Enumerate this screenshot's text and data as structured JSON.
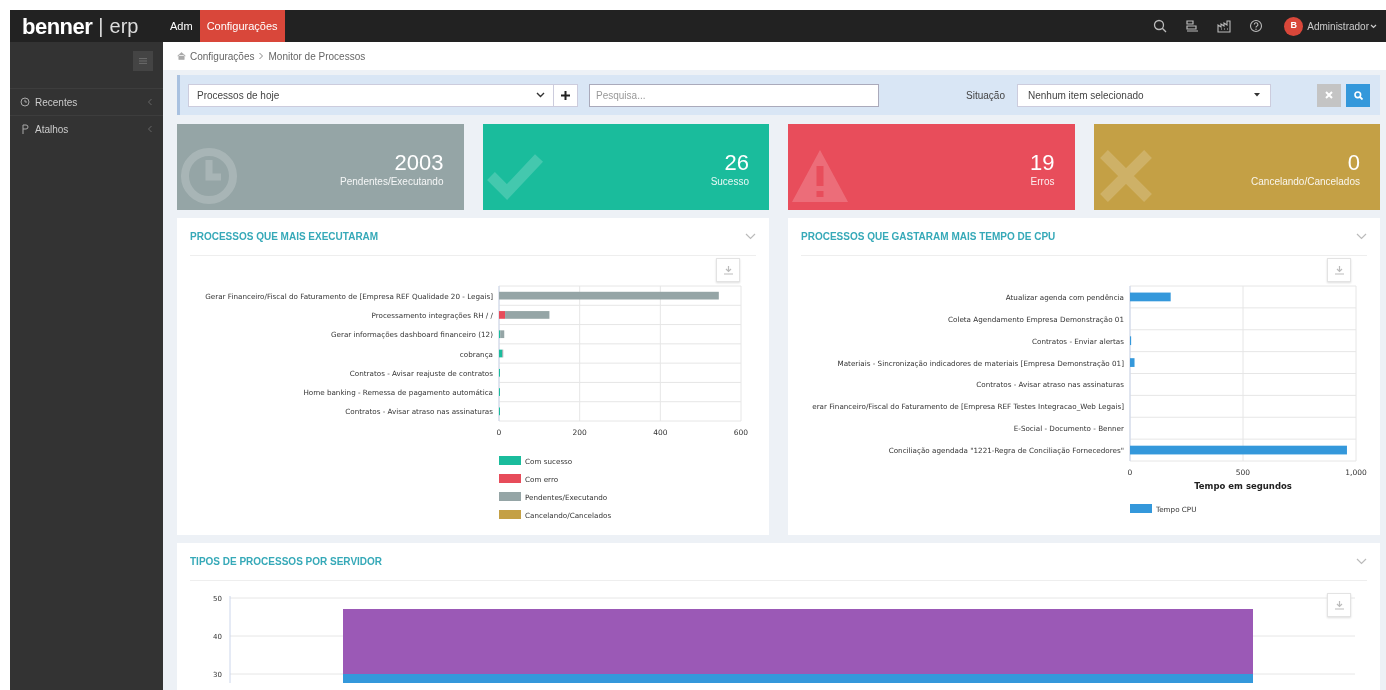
{
  "top_bar": {
    "brand": "benner",
    "separator": "|",
    "product": "erp",
    "tabs": [
      {
        "label": "Adm",
        "selected": false
      },
      {
        "label": "Configurações",
        "selected": true
      }
    ],
    "user": {
      "initial": "B",
      "name": "Administrador"
    }
  },
  "sidebar": {
    "items": [
      {
        "label": "Recentes",
        "kind": "recent"
      },
      {
        "label": "Atalhos",
        "kind": "shortcut"
      }
    ]
  },
  "breadcrumb": [
    "Configurações",
    "Monitor de Processos"
  ],
  "filter_bar": {
    "preset": "Processos de hoje",
    "search_placeholder": "Pesquisa...",
    "status_label": "Situação",
    "status_value": "Nenhum item selecionado"
  },
  "stat_cards": [
    {
      "value": "2003",
      "label": "Pendentes/Executando",
      "kind": "pending"
    },
    {
      "value": "26",
      "label": "Sucesso",
      "kind": "success"
    },
    {
      "value": "19",
      "label": "Erros",
      "kind": "error"
    },
    {
      "value": "0",
      "label": "Cancelando/Cancelados",
      "kind": "cancelled"
    }
  ],
  "panels": [
    {
      "title": "PROCESSOS QUE MAIS EXECUTARAM",
      "chart_data": {
        "type": "bar",
        "orientation": "horizontal",
        "stacked": true,
        "categories": [
          "Gerar Financeiro/Fiscal do Faturamento de [Empresa REF Qualidade 20 - Legais]",
          "Processamento integrações RH / /",
          "Gerar informações dashboard financeiro (12)",
          "cobrança",
          "Contratos - Avisar reajuste de contratos",
          "Home banking - Remessa de pagamento automática",
          "Contratos - Avisar atraso nas assinaturas"
        ],
        "series": [
          {
            "name": "Com sucesso",
            "color": "#1abc9c",
            "values": [
              0,
              0,
              3,
              8,
              1,
              1,
              1
            ]
          },
          {
            "name": "Com erro",
            "color": "#e74c5a",
            "values": [
              0,
              15,
              0,
              0,
              0,
              0,
              0
            ]
          },
          {
            "name": "Pendentes/Executando",
            "color": "#95a5a6",
            "values": [
              545,
              110,
              10,
              2,
              0,
              0,
              0
            ]
          },
          {
            "name": "Cancelando/Cancelados",
            "color": "#c4a045",
            "values": [
              0,
              0,
              0,
              0,
              0,
              0,
              0
            ]
          }
        ],
        "xlim": [
          0,
          600
        ],
        "xticks": [
          0,
          200,
          400,
          600
        ],
        "legend": "bottom"
      }
    },
    {
      "title": "PROCESSOS QUE GASTARAM MAIS TEMPO DE CPU",
      "chart_data": {
        "type": "bar",
        "orientation": "horizontal",
        "xlabel": "Tempo em segundos",
        "categories": [
          "Atualizar agenda com pendência",
          "Coleta Agendamento Empresa Demonstração 01",
          "Contratos - Enviar alertas",
          "Materiais - Sincronização indicadores de materiais [Empresa Demonstração 01]",
          "Contratos - Avisar atraso nas assinaturas",
          "erar Financeiro/Fiscal do Faturamento de [Empresa REF Testes Integracao_Web Legais]",
          "E-Social - Documento - Benner",
          "Conciliação agendada \"1221-Regra de Conciliação Fornecedores\""
        ],
        "series": [
          {
            "name": "Tempo CPU",
            "color": "#3498db",
            "values": [
              180,
              0,
              5,
              20,
              0,
              0,
              0,
              960
            ]
          }
        ],
        "xlim": [
          0,
          1000
        ],
        "xticks": [
          0,
          500,
          {
            "value": 1000,
            "label": "1,000"
          }
        ],
        "legend": "bottom"
      }
    },
    {
      "title": "TIPOS DE PROCESSOS POR SERVIDOR",
      "y_axis_labels": [
        "50",
        "40",
        "30"
      ]
    }
  ]
}
